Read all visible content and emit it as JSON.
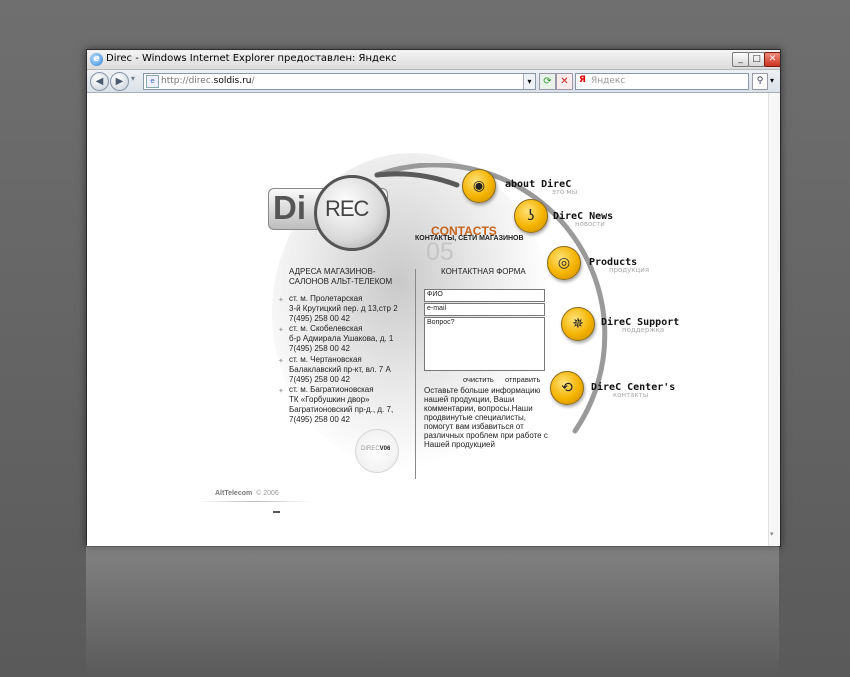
{
  "window": {
    "title": "Direc - Windows Internet Explorer предоставлен: Яндекс",
    "minimize": "_",
    "maximize": "□",
    "close": "✕"
  },
  "toolbar": {
    "back_icon": "back-arrow-icon",
    "forward_icon": "forward-arrow-icon",
    "url_prefix": "http://direc.",
    "url_domain": "soldis.ru",
    "url_suffix": "/",
    "search_placeholder": "Яндекс",
    "refresh_icon": "refresh-icon",
    "stop_icon": "stop-icon",
    "go_icon": "search-icon"
  },
  "site": {
    "logo_di": "Di",
    "logo_rec": "REC",
    "section_title": "CONTACTS",
    "section_subtitle": "КОНТАКТЫ, СЕТИ МАГАЗИНОВ",
    "section_number": "05",
    "stores_heading_1": "АДРЕСА МАГАЗИНОВ-",
    "stores_heading_2": "САЛОНОВ АЛЬТ-ТЕЛЕКОМ",
    "stores": [
      {
        "l1": "ст. м. Пролетарская",
        "l2": "3-й Крутицкий пер. д 13,стр 2",
        "l3": "7(495) 258 00 42"
      },
      {
        "l1": "ст. м. Скобелевская",
        "l2": "б-р Адмирала Ушакова, д. 1",
        "l3": "7(495) 258 00 42"
      },
      {
        "l1": "ст. м. Чертановская",
        "l2": "Балаклавский пр-кт, вл. 7 А",
        "l3": "7(495) 258 00 42"
      },
      {
        "l1": "ст. м. Багратионовская",
        "l2": "ТК «Горбушкин двор»",
        "l3": "Багратионовский пр-д., д. 7,",
        "l4": "7(495) 258 00 42"
      }
    ],
    "form_heading": "КОНТАКТНАЯ ФОРМА",
    "field_fio": "ФИО",
    "field_email": "e-mail",
    "field_question": "Вопрос?",
    "btn_clear": "очистить",
    "btn_send": "отправить",
    "form_note_1": "Оставьте больше информацию",
    "form_note_2": "нашей продукции, Ваши",
    "form_note_3": "комментарии, вопросы.Наши",
    "form_note_4": "продвинутые специалисты,",
    "form_note_5": "помогут вам избавиться от",
    "form_note_6": "различных проблем при работе с",
    "form_note_7": "Нашей продукцией",
    "version_a": "DIREC",
    "version_b": "V06",
    "footer_company": "AltTelecom",
    "footer_year": "© 2006",
    "menu": [
      {
        "label": "about DireC",
        "sub": "это мы",
        "icon": "eye-icon",
        "glyph": "◉"
      },
      {
        "label": "DireC News",
        "sub": "новости",
        "icon": "ear-icon",
        "glyph": "ʖ"
      },
      {
        "label": "Products",
        "sub": "продукция",
        "icon": "disc-icon",
        "glyph": "◎"
      },
      {
        "label": "DireC Support",
        "sub": "поддержка",
        "icon": "web-icon",
        "glyph": "✵"
      },
      {
        "label": "DireC Center's",
        "sub": "контакты",
        "icon": "arrows-icon",
        "glyph": "⟲"
      }
    ]
  },
  "colors": {
    "accent": "#f4b300",
    "title_orange": "#c8631a"
  }
}
